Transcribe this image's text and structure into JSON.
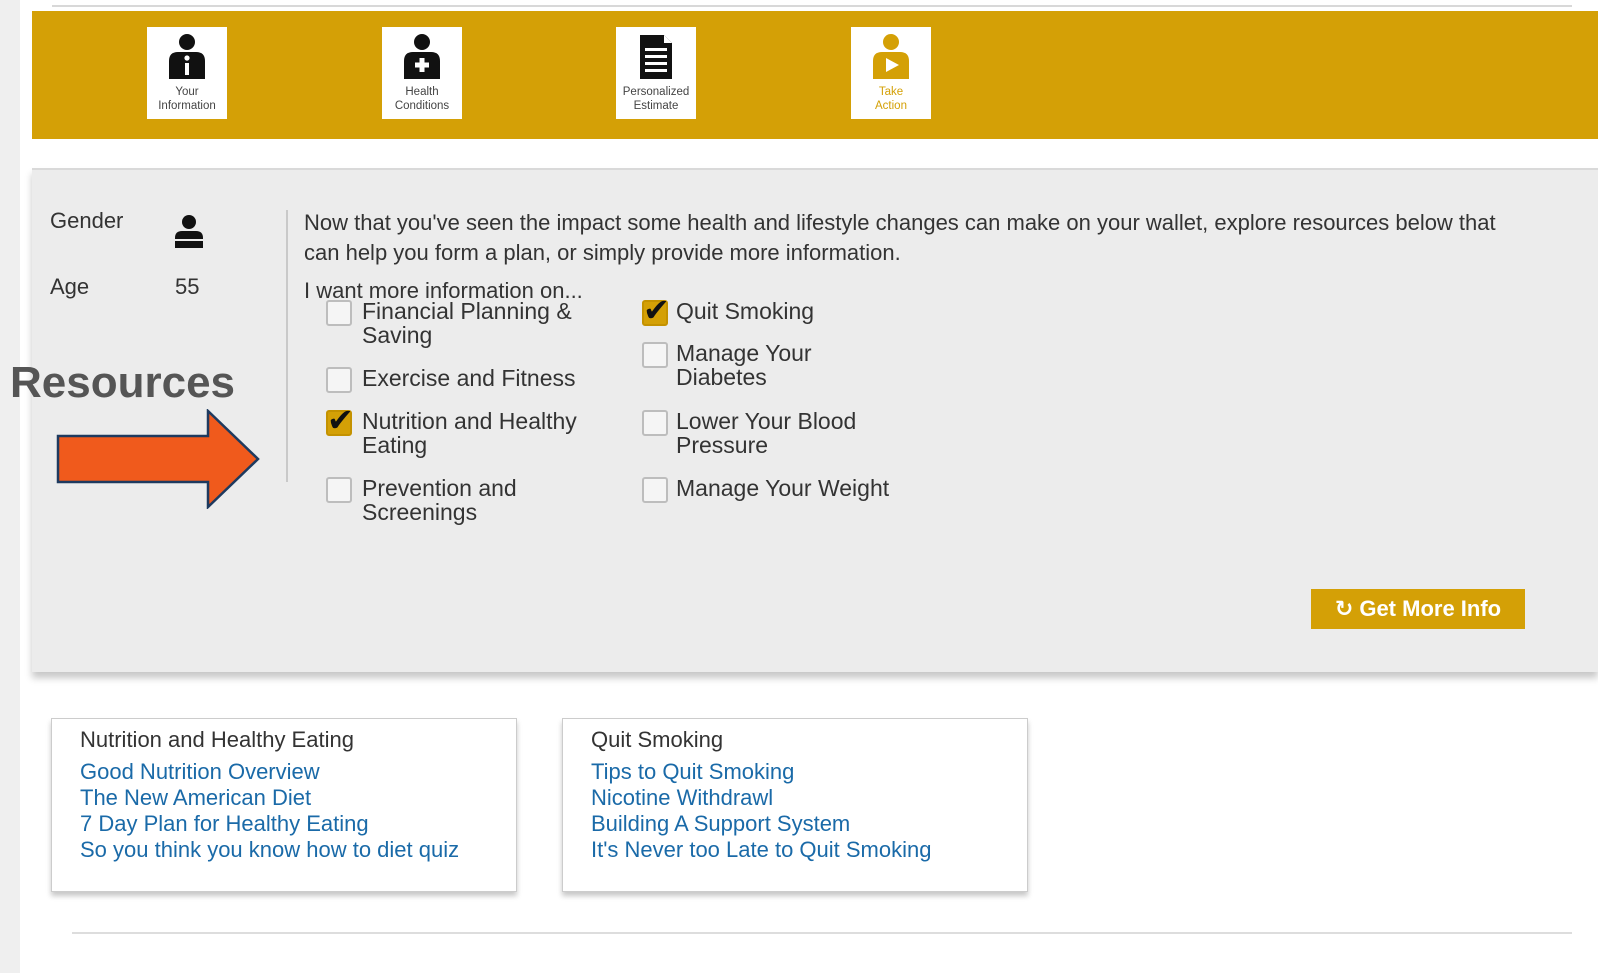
{
  "steps": [
    {
      "label": "Your\nInformation",
      "icon": "info-person-icon"
    },
    {
      "label": "Health\nConditions",
      "icon": "health-person-icon"
    },
    {
      "label": "Personalized\nEstimate",
      "icon": "document-icon"
    },
    {
      "label": "Take\nAction",
      "icon": "play-person-icon",
      "active": true
    }
  ],
  "profile": {
    "gender_label": "Gender",
    "age_label": "Age",
    "age_value": "55"
  },
  "annotation": {
    "title": "Resources",
    "arrow_color": "#f05a1c"
  },
  "intro": "Now that you've seen the impact some health and lifestyle changes can make on your wallet, explore resources below that can help you form a plan, or simply provide more information.",
  "want_label": "I want more information on...",
  "options": [
    {
      "label": "Financial Planning & Saving",
      "checked": false
    },
    {
      "label": "Exercise and Fitness",
      "checked": false
    },
    {
      "label": "Nutrition and Healthy Eating",
      "checked": true
    },
    {
      "label": "Prevention and Screenings",
      "checked": false
    },
    {
      "label": "Quit Smoking",
      "checked": true
    },
    {
      "label": "Manage Your Diabetes",
      "checked": false
    },
    {
      "label": "Lower Your Blood Pressure",
      "checked": false
    },
    {
      "label": "Manage Your Weight",
      "checked": false
    }
  ],
  "get_more_info_label": "Get More Info",
  "resource_boxes": [
    {
      "title": "Nutrition and Healthy Eating",
      "links": [
        "Good Nutrition Overview",
        "The New American Diet",
        "7 Day Plan for Healthy Eating",
        "So you think you know how to diet quiz"
      ]
    },
    {
      "title": "Quit Smoking",
      "links": [
        "Tips to Quit Smoking",
        "Nicotine Withdrawl",
        "Building A Support System",
        "It's Never too Late to Quit Smoking"
      ]
    }
  ],
  "colors": {
    "brand_gold": "#d4a006",
    "link_blue": "#1a6aa8",
    "panel_gray": "#ececec"
  }
}
